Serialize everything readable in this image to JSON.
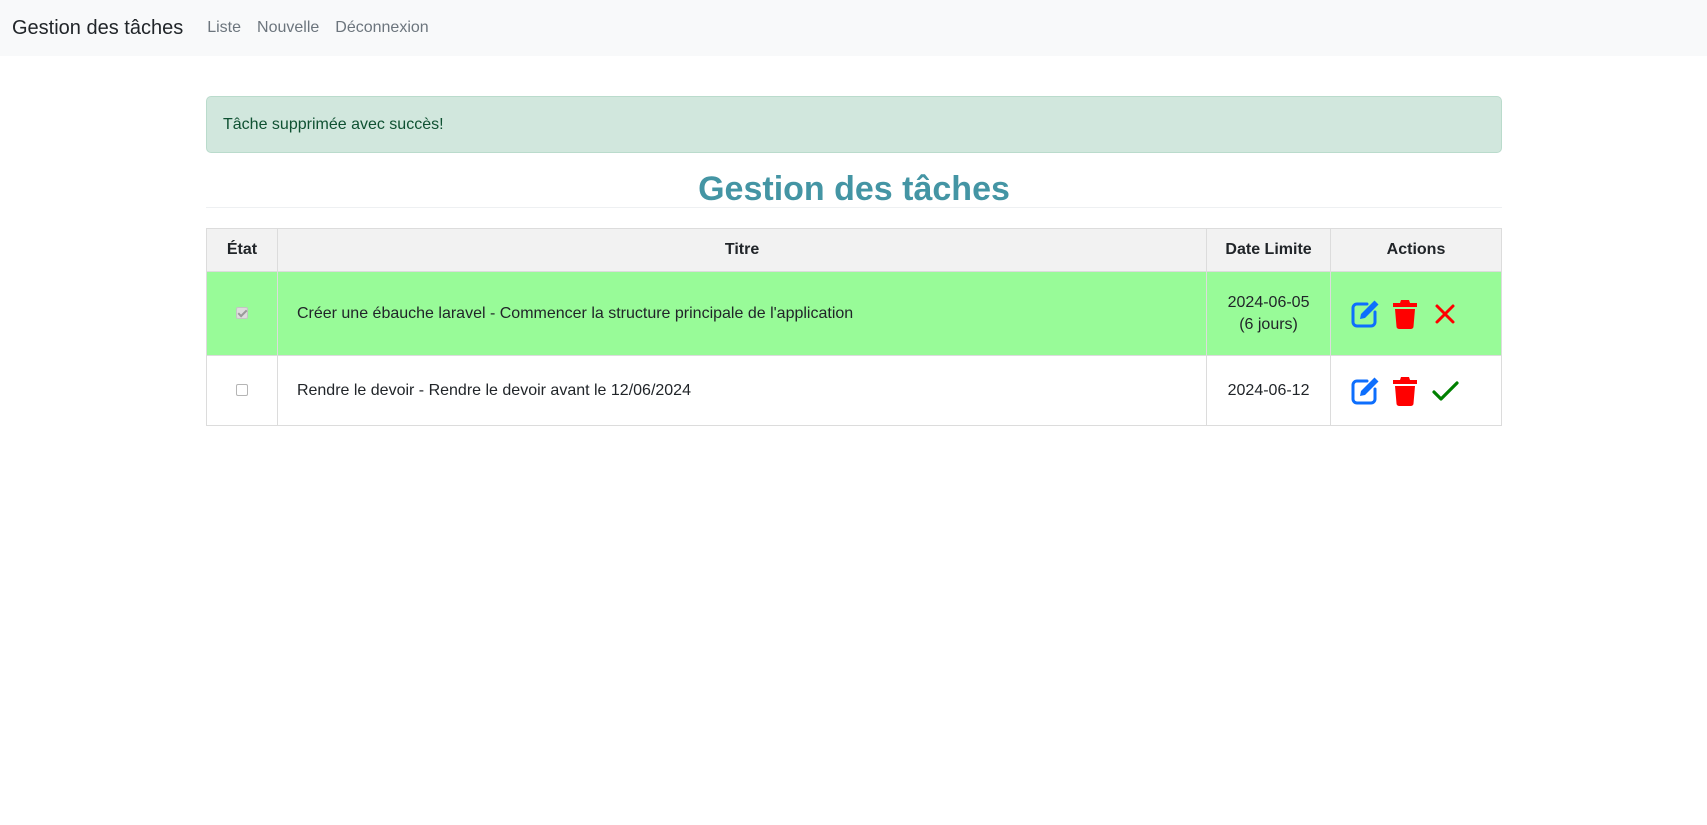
{
  "navbar": {
    "brand": "Gestion des tâches",
    "links": [
      "Liste",
      "Nouvelle",
      "Déconnexion"
    ]
  },
  "alert": {
    "message": "Tâche supprimée avec succès!"
  },
  "page_title": "Gestion des tâches",
  "table": {
    "headers": [
      "État",
      "Titre",
      "Date Limite",
      "Actions"
    ],
    "rows": [
      {
        "checked": true,
        "title": "Créer une ébauche laravel - Commencer la structure principale de l'application",
        "date": "2024-06-05",
        "date_note": "(6 jours)",
        "actions": [
          "edit-icon",
          "trash-icon",
          "close-icon"
        ]
      },
      {
        "checked": false,
        "title": "Rendre le devoir - Rendre le devoir avant le 12/06/2024",
        "date": "2024-06-12",
        "date_note": "",
        "actions": [
          "edit-icon",
          "trash-icon",
          "check-icon"
        ]
      }
    ]
  },
  "colors": {
    "navbar_bg": "#f8f9fa",
    "alert_bg": "#d1e7dd",
    "title": "#4495a4",
    "done_row_bg": "#98fb98",
    "edit_icon": "#0d6efd",
    "delete_icon": "#ff0000",
    "cancel_icon": "#ff0000",
    "complete_icon": "#008000"
  }
}
